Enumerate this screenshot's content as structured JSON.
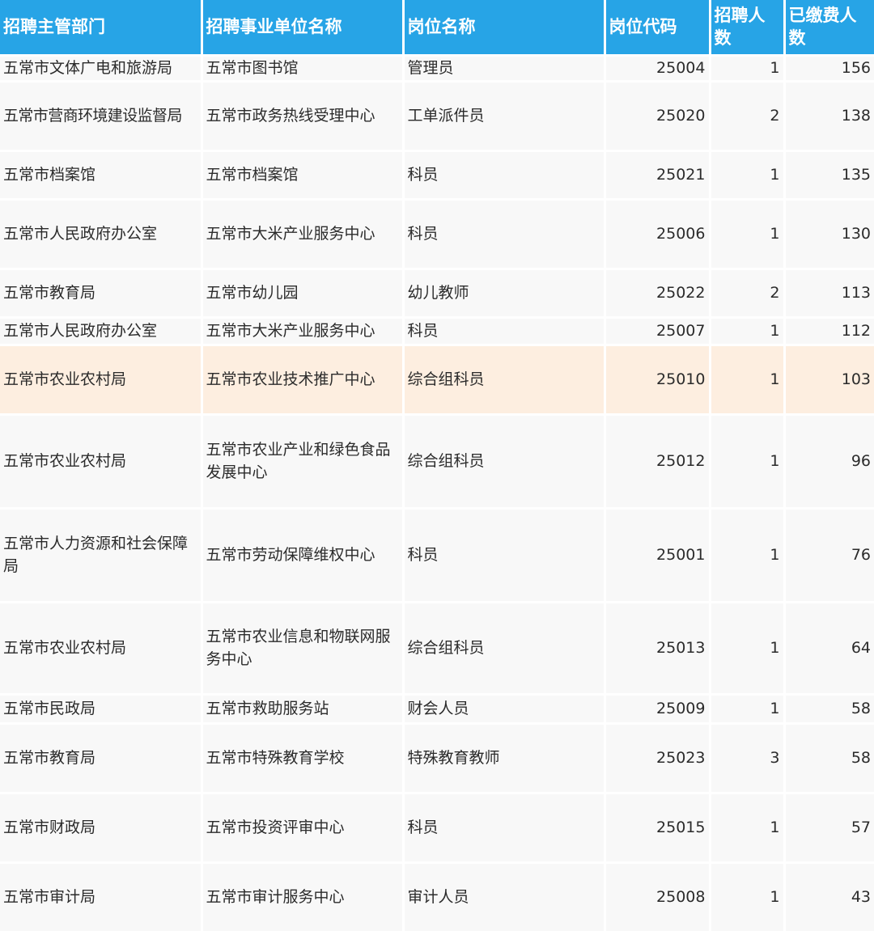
{
  "header": {
    "dept": "招聘主管部门",
    "unit": "招聘事业单位名称",
    "post": "岗位名称",
    "code": "岗位代码",
    "hires": "招聘人数",
    "paid": "已缴费人数"
  },
  "colors": {
    "header_bg": "#27a4e6",
    "row_bg": "#f8f8f8",
    "highlight_bg": "#fdeee0"
  },
  "rows": [
    {
      "dept": "五常市文体广电和旅游局",
      "unit": "五常市图书馆",
      "post": "管理员",
      "code": "25004",
      "hires": "1",
      "paid": "156"
    },
    {
      "dept": "五常市营商环境建设监督局",
      "unit": "五常市政务热线受理中心",
      "post": "工单派件员",
      "code": "25020",
      "hires": "2",
      "paid": "138"
    },
    {
      "dept": "五常市档案馆",
      "unit": "五常市档案馆",
      "post": "科员",
      "code": "25021",
      "hires": "1",
      "paid": "135"
    },
    {
      "dept": "五常市人民政府办公室",
      "unit": "五常市大米产业服务中心",
      "post": "科员",
      "code": "25006",
      "hires": "1",
      "paid": "130"
    },
    {
      "dept": "五常市教育局",
      "unit": "五常市幼儿园",
      "post": "幼儿教师",
      "code": "25022",
      "hires": "2",
      "paid": "113"
    },
    {
      "dept": "五常市人民政府办公室",
      "unit": "五常市大米产业服务中心",
      "post": "科员",
      "code": "25007",
      "hires": "1",
      "paid": "112"
    },
    {
      "dept": "五常市农业农村局",
      "unit": "五常市农业技术推广中心",
      "post": "综合组科员",
      "code": "25010",
      "hires": "1",
      "paid": "103"
    },
    {
      "dept": "五常市农业农村局",
      "unit": "五常市农业产业和绿色食品发展中心",
      "post": "综合组科员",
      "code": "25012",
      "hires": "1",
      "paid": "96"
    },
    {
      "dept": "五常市人力资源和社会保障局",
      "unit": "五常市劳动保障维权中心",
      "post": "科员",
      "code": "25001",
      "hires": "1",
      "paid": "76"
    },
    {
      "dept": "五常市农业农村局",
      "unit": "五常市农业信息和物联网服务中心",
      "post": "综合组科员",
      "code": "25013",
      "hires": "1",
      "paid": "64"
    },
    {
      "dept": "五常市民政局",
      "unit": "五常市救助服务站",
      "post": "财会人员",
      "code": "25009",
      "hires": "1",
      "paid": "58"
    },
    {
      "dept": "五常市教育局",
      "unit": "五常市特殊教育学校",
      "post": "特殊教育教师",
      "code": "25023",
      "hires": "3",
      "paid": "58"
    },
    {
      "dept": "五常市财政局",
      "unit": "五常市投资评审中心",
      "post": "科员",
      "code": "25015",
      "hires": "1",
      "paid": "57"
    },
    {
      "dept": "五常市审计局",
      "unit": "五常市审计服务中心",
      "post": "审计人员",
      "code": "25008",
      "hires": "1",
      "paid": "43"
    }
  ]
}
